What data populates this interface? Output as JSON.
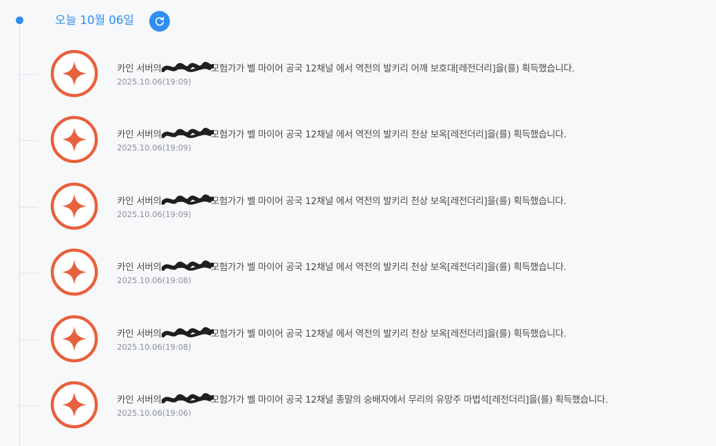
{
  "header": {
    "date_label": "오늘 10월 06일",
    "refresh_icon": "refresh-icon"
  },
  "colors": {
    "accent": "#2f8ff0",
    "badge": "#e8603c",
    "redaction": "#1f1f1f"
  },
  "entries": [
    {
      "prefix": "카인 서버의",
      "suffix": "모험가가 벨 마이어 공국 12채널 에서 역전의 발키리 어깨 보호대[레전더리]을(를) 획득했습니다.",
      "timestamp": "2025.10.06(19:09)",
      "icon": "sparkle-icon"
    },
    {
      "prefix": "카인 서버의",
      "suffix": "모험가가 벨 마이어 공국 12채널 에서 역전의 발키리 천상 보옥[레전더리]을(를) 획득했습니다.",
      "timestamp": "2025.10.06(19:09)",
      "icon": "sparkle-icon"
    },
    {
      "prefix": "카인 서버의",
      "suffix": "모험가가 벨 마이어 공국 12채널 에서 역전의 발키리 천상 보옥[레전더리]을(를) 획득했습니다.",
      "timestamp": "2025.10.06(19:09)",
      "icon": "sparkle-icon"
    },
    {
      "prefix": "카인 서버의",
      "suffix": "모험가가 벨 마이어 공국 12채널 에서 역전의 발키리 천상 보옥[레전더리]을(를) 획득했습니다.",
      "timestamp": "2025.10.06(19:08)",
      "icon": "sparkle-icon"
    },
    {
      "prefix": "카인 서버의",
      "suffix": "모험가가 벨 마이어 공국 12채널 에서 역전의 발키리 천상 보옥[레전더리]을(를) 획득했습니다.",
      "timestamp": "2025.10.06(19:08)",
      "icon": "sparkle-icon"
    },
    {
      "prefix": "카인 서버의",
      "suffix": "모험가가 벨 마이어 공국 12채널 종말의 숭배자에서 무리의 유망주 마법석[레전더리]을(를) 획득했습니다.",
      "timestamp": "2025.10.06(19:06)",
      "icon": "sparkle-icon"
    }
  ]
}
